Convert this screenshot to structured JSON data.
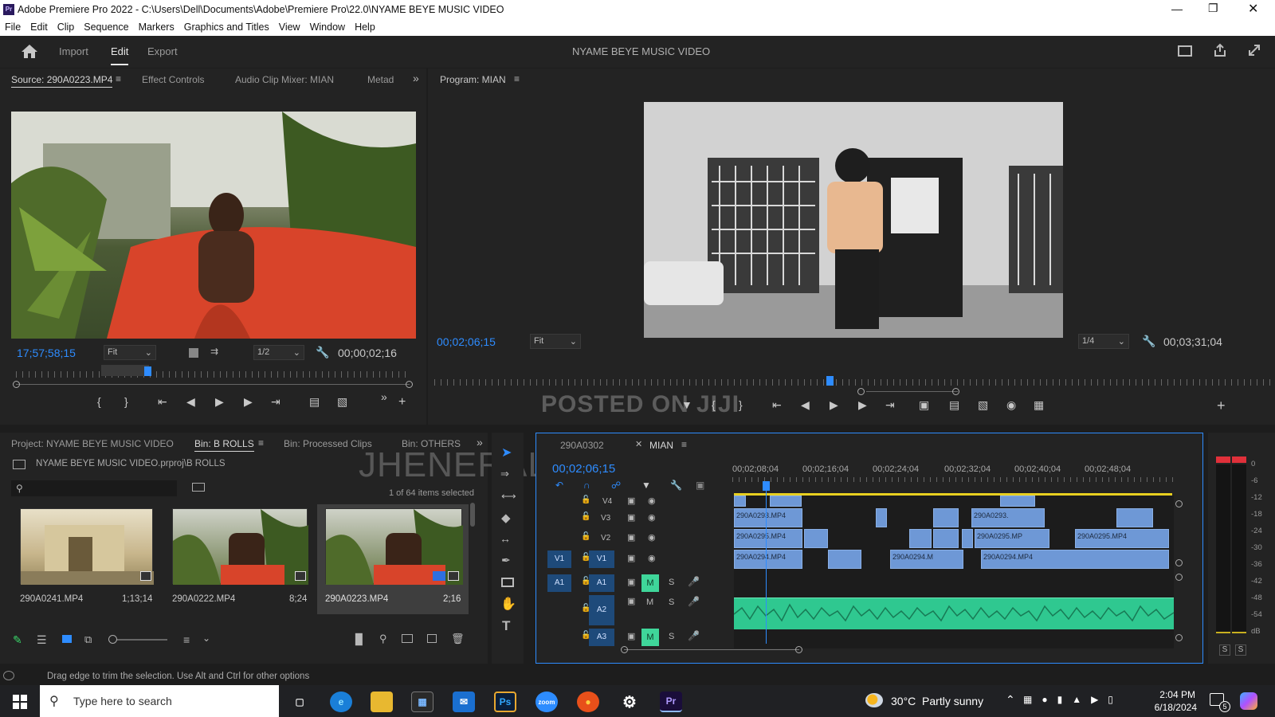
{
  "window": {
    "title": "Adobe Premiere Pro 2022 - C:\\Users\\Dell\\Documents\\Adobe\\Premiere Pro\\22.0\\NYAME BEYE MUSIC VIDEO",
    "app_icon": "Pr"
  },
  "menu": [
    "File",
    "Edit",
    "Clip",
    "Sequence",
    "Markers",
    "Graphics and Titles",
    "View",
    "Window",
    "Help"
  ],
  "topnav": {
    "tabs": [
      "Import",
      "Edit",
      "Export"
    ],
    "active": "Edit",
    "project_title": "NYAME BEYE MUSIC VIDEO"
  },
  "source_panel": {
    "tabs": [
      "Source: 290A0223.MP4",
      "Effect Controls",
      "Audio Clip Mixer: MIAN",
      "Metad"
    ],
    "timecode_in": "17;57;58;15",
    "fit": "Fit",
    "resolution": "1/2",
    "duration": "00;00;02;16"
  },
  "program_panel": {
    "tab": "Program: MIAN",
    "timecode": "00;02;06;15",
    "fit": "Fit",
    "resolution": "1/4",
    "duration": "00;03;31;04"
  },
  "watermarks": {
    "posted": "POSTED ON JIJI",
    "name": "JHENERAL OHENEBA KOFI"
  },
  "project_panel": {
    "tabs": [
      "Project: NYAME BEYE MUSIC VIDEO",
      "Bin: B ROLLS",
      "Bin: Processed Clips",
      "Bin: OTHERS"
    ],
    "active_tab": "Bin: B ROLLS",
    "path": "NYAME BEYE MUSIC VIDEO.prproj\\B ROLLS",
    "search_placeholder": "",
    "selection_info": "1 of 64 items selected",
    "items": [
      {
        "name": "290A0241.MP4",
        "duration": "1;13;14"
      },
      {
        "name": "290A0222.MP4",
        "duration": "8;24"
      },
      {
        "name": "290A0223.MP4",
        "duration": "2;16"
      }
    ]
  },
  "timeline": {
    "tabs": [
      "290A0302",
      "MIAN"
    ],
    "timecode": "00;02;06;15",
    "ruler": [
      "00;02;08;04",
      "00;02;16;04",
      "00;02;24;04",
      "00;02;32;04",
      "00;02;40;04",
      "00;02;48;04"
    ],
    "video_tracks": [
      "V4",
      "V3",
      "V2",
      "V1"
    ],
    "audio_tracks": [
      "A1",
      "A2",
      "A3"
    ],
    "source_v": "V1",
    "source_a": "A1",
    "mute_label": "M",
    "solo_label": "S",
    "clips": {
      "v3a": "290A0293.MP4",
      "v3b": "290A0293.",
      "v2a": "290A0295.MP4",
      "v2b": "290A0295.MP",
      "v2c": "290A0295.MP4",
      "v1a": "290A0294.MP4",
      "v1b": "290A0294.M",
      "v1c": "290A0294.MP4"
    }
  },
  "meter": {
    "labels": [
      "0",
      "-6",
      "-12",
      "-18",
      "-24",
      "-30",
      "-36",
      "-42",
      "-48",
      "-54",
      "dB"
    ],
    "solo": [
      "S",
      "S"
    ]
  },
  "status": "Drag edge to trim the selection. Use Alt and Ctrl for other options",
  "taskbar": {
    "search_placeholder": "Type here to search",
    "weather": "30°C  Partly sunny",
    "time": "2:04 PM",
    "date": "6/18/2024",
    "notification_count": "5",
    "apps": [
      "task-view",
      "edge",
      "file-explorer",
      "store",
      "mail",
      "photoshop",
      "zoom",
      "firefox",
      "settings",
      "premiere"
    ]
  },
  "colors": {
    "accent_blue": "#2e8cff",
    "clip_blue": "#6e98d6",
    "audio_green": "#3fd6a0",
    "mute_green": "#3fd69a",
    "work_area_yellow": "#e8d020"
  }
}
